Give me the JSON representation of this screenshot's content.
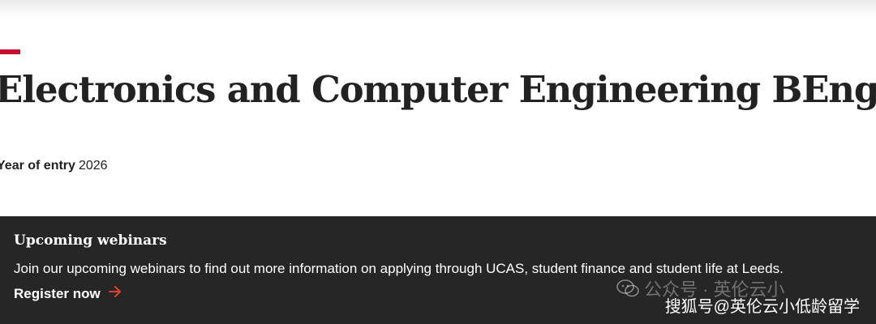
{
  "header": {
    "title": "Electronics and Computer Engineering BEng",
    "accent_color": "#c8102e"
  },
  "entry": {
    "label": "Year of entry",
    "value": "2026"
  },
  "webinar": {
    "title": "Upcoming webinars",
    "description": "Join our upcoming webinars to find out more information on applying through UCAS, student finance and student life at Leeds.",
    "cta_label": "Register now",
    "cta_icon": "arrow-right-icon",
    "background": "#262626"
  },
  "watermark": {
    "line1": "公众号 · 英伦云小",
    "line2": "搜狐号@英伦云小低龄留学",
    "icon": "wechat-icon"
  }
}
